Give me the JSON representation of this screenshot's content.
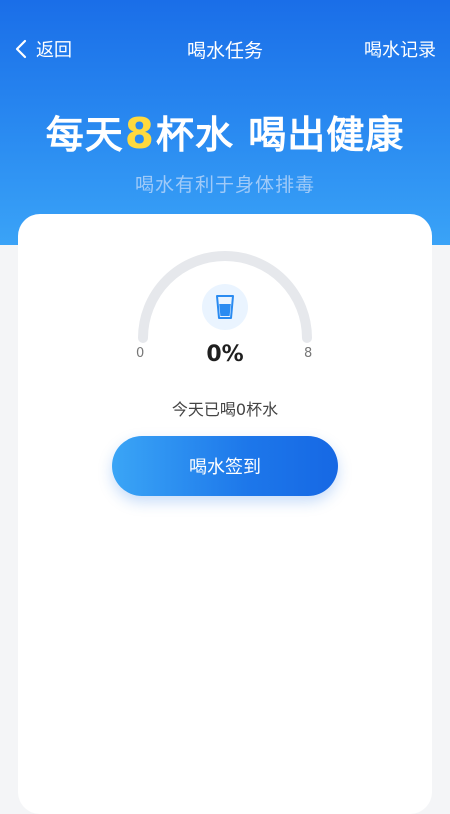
{
  "nav": {
    "back_label": "返回",
    "title": "喝水任务",
    "right_label": "喝水记录"
  },
  "hero": {
    "title_prefix": "每天",
    "title_number": "8",
    "title_suffix": "杯水 喝出健康",
    "subtitle": "喝水有利于身体排毒"
  },
  "progress": {
    "min": "0",
    "max": "8",
    "current": 0,
    "percent_label": "0%",
    "status_text": "今天已喝0杯水"
  },
  "actions": {
    "checkin_label": "喝水签到"
  },
  "colors": {
    "header_blue": "#1a6ee8",
    "accent_yellow": "#ffd93d",
    "gauge_track": "#e6e8ec",
    "button_blue": "#1d77ea"
  },
  "icons": {
    "back": "chevron-left-icon",
    "cup": "water-cup-icon"
  }
}
